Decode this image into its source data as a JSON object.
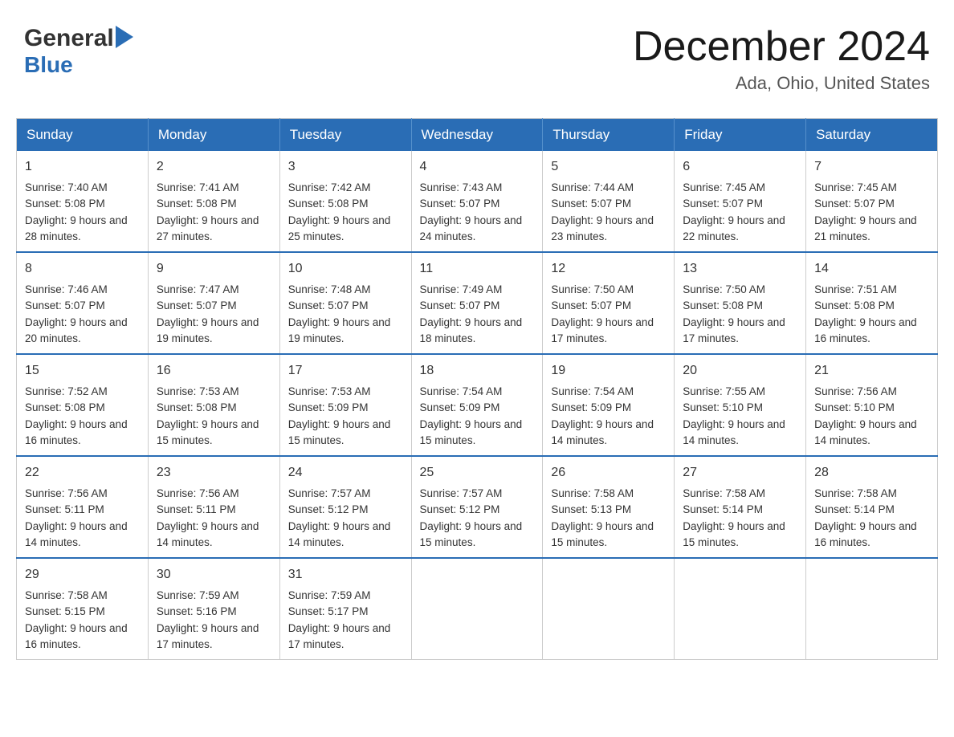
{
  "header": {
    "logo_general": "General",
    "logo_blue": "Blue",
    "title": "December 2024",
    "location": "Ada, Ohio, United States"
  },
  "days_of_week": [
    "Sunday",
    "Monday",
    "Tuesday",
    "Wednesday",
    "Thursday",
    "Friday",
    "Saturday"
  ],
  "weeks": [
    [
      {
        "num": "1",
        "sunrise": "7:40 AM",
        "sunset": "5:08 PM",
        "daylight": "9 hours and 28 minutes."
      },
      {
        "num": "2",
        "sunrise": "7:41 AM",
        "sunset": "5:08 PM",
        "daylight": "9 hours and 27 minutes."
      },
      {
        "num": "3",
        "sunrise": "7:42 AM",
        "sunset": "5:08 PM",
        "daylight": "9 hours and 25 minutes."
      },
      {
        "num": "4",
        "sunrise": "7:43 AM",
        "sunset": "5:07 PM",
        "daylight": "9 hours and 24 minutes."
      },
      {
        "num": "5",
        "sunrise": "7:44 AM",
        "sunset": "5:07 PM",
        "daylight": "9 hours and 23 minutes."
      },
      {
        "num": "6",
        "sunrise": "7:45 AM",
        "sunset": "5:07 PM",
        "daylight": "9 hours and 22 minutes."
      },
      {
        "num": "7",
        "sunrise": "7:45 AM",
        "sunset": "5:07 PM",
        "daylight": "9 hours and 21 minutes."
      }
    ],
    [
      {
        "num": "8",
        "sunrise": "7:46 AM",
        "sunset": "5:07 PM",
        "daylight": "9 hours and 20 minutes."
      },
      {
        "num": "9",
        "sunrise": "7:47 AM",
        "sunset": "5:07 PM",
        "daylight": "9 hours and 19 minutes."
      },
      {
        "num": "10",
        "sunrise": "7:48 AM",
        "sunset": "5:07 PM",
        "daylight": "9 hours and 19 minutes."
      },
      {
        "num": "11",
        "sunrise": "7:49 AM",
        "sunset": "5:07 PM",
        "daylight": "9 hours and 18 minutes."
      },
      {
        "num": "12",
        "sunrise": "7:50 AM",
        "sunset": "5:07 PM",
        "daylight": "9 hours and 17 minutes."
      },
      {
        "num": "13",
        "sunrise": "7:50 AM",
        "sunset": "5:08 PM",
        "daylight": "9 hours and 17 minutes."
      },
      {
        "num": "14",
        "sunrise": "7:51 AM",
        "sunset": "5:08 PM",
        "daylight": "9 hours and 16 minutes."
      }
    ],
    [
      {
        "num": "15",
        "sunrise": "7:52 AM",
        "sunset": "5:08 PM",
        "daylight": "9 hours and 16 minutes."
      },
      {
        "num": "16",
        "sunrise": "7:53 AM",
        "sunset": "5:08 PM",
        "daylight": "9 hours and 15 minutes."
      },
      {
        "num": "17",
        "sunrise": "7:53 AM",
        "sunset": "5:09 PM",
        "daylight": "9 hours and 15 minutes."
      },
      {
        "num": "18",
        "sunrise": "7:54 AM",
        "sunset": "5:09 PM",
        "daylight": "9 hours and 15 minutes."
      },
      {
        "num": "19",
        "sunrise": "7:54 AM",
        "sunset": "5:09 PM",
        "daylight": "9 hours and 14 minutes."
      },
      {
        "num": "20",
        "sunrise": "7:55 AM",
        "sunset": "5:10 PM",
        "daylight": "9 hours and 14 minutes."
      },
      {
        "num": "21",
        "sunrise": "7:56 AM",
        "sunset": "5:10 PM",
        "daylight": "9 hours and 14 minutes."
      }
    ],
    [
      {
        "num": "22",
        "sunrise": "7:56 AM",
        "sunset": "5:11 PM",
        "daylight": "9 hours and 14 minutes."
      },
      {
        "num": "23",
        "sunrise": "7:56 AM",
        "sunset": "5:11 PM",
        "daylight": "9 hours and 14 minutes."
      },
      {
        "num": "24",
        "sunrise": "7:57 AM",
        "sunset": "5:12 PM",
        "daylight": "9 hours and 14 minutes."
      },
      {
        "num": "25",
        "sunrise": "7:57 AM",
        "sunset": "5:12 PM",
        "daylight": "9 hours and 15 minutes."
      },
      {
        "num": "26",
        "sunrise": "7:58 AM",
        "sunset": "5:13 PM",
        "daylight": "9 hours and 15 minutes."
      },
      {
        "num": "27",
        "sunrise": "7:58 AM",
        "sunset": "5:14 PM",
        "daylight": "9 hours and 15 minutes."
      },
      {
        "num": "28",
        "sunrise": "7:58 AM",
        "sunset": "5:14 PM",
        "daylight": "9 hours and 16 minutes."
      }
    ],
    [
      {
        "num": "29",
        "sunrise": "7:58 AM",
        "sunset": "5:15 PM",
        "daylight": "9 hours and 16 minutes."
      },
      {
        "num": "30",
        "sunrise": "7:59 AM",
        "sunset": "5:16 PM",
        "daylight": "9 hours and 17 minutes."
      },
      {
        "num": "31",
        "sunrise": "7:59 AM",
        "sunset": "5:17 PM",
        "daylight": "9 hours and 17 minutes."
      },
      null,
      null,
      null,
      null
    ]
  ],
  "labels": {
    "sunrise": "Sunrise:",
    "sunset": "Sunset:",
    "daylight": "Daylight:"
  },
  "colors": {
    "header_bg": "#2a6db5",
    "border_accent": "#2a6db5"
  }
}
